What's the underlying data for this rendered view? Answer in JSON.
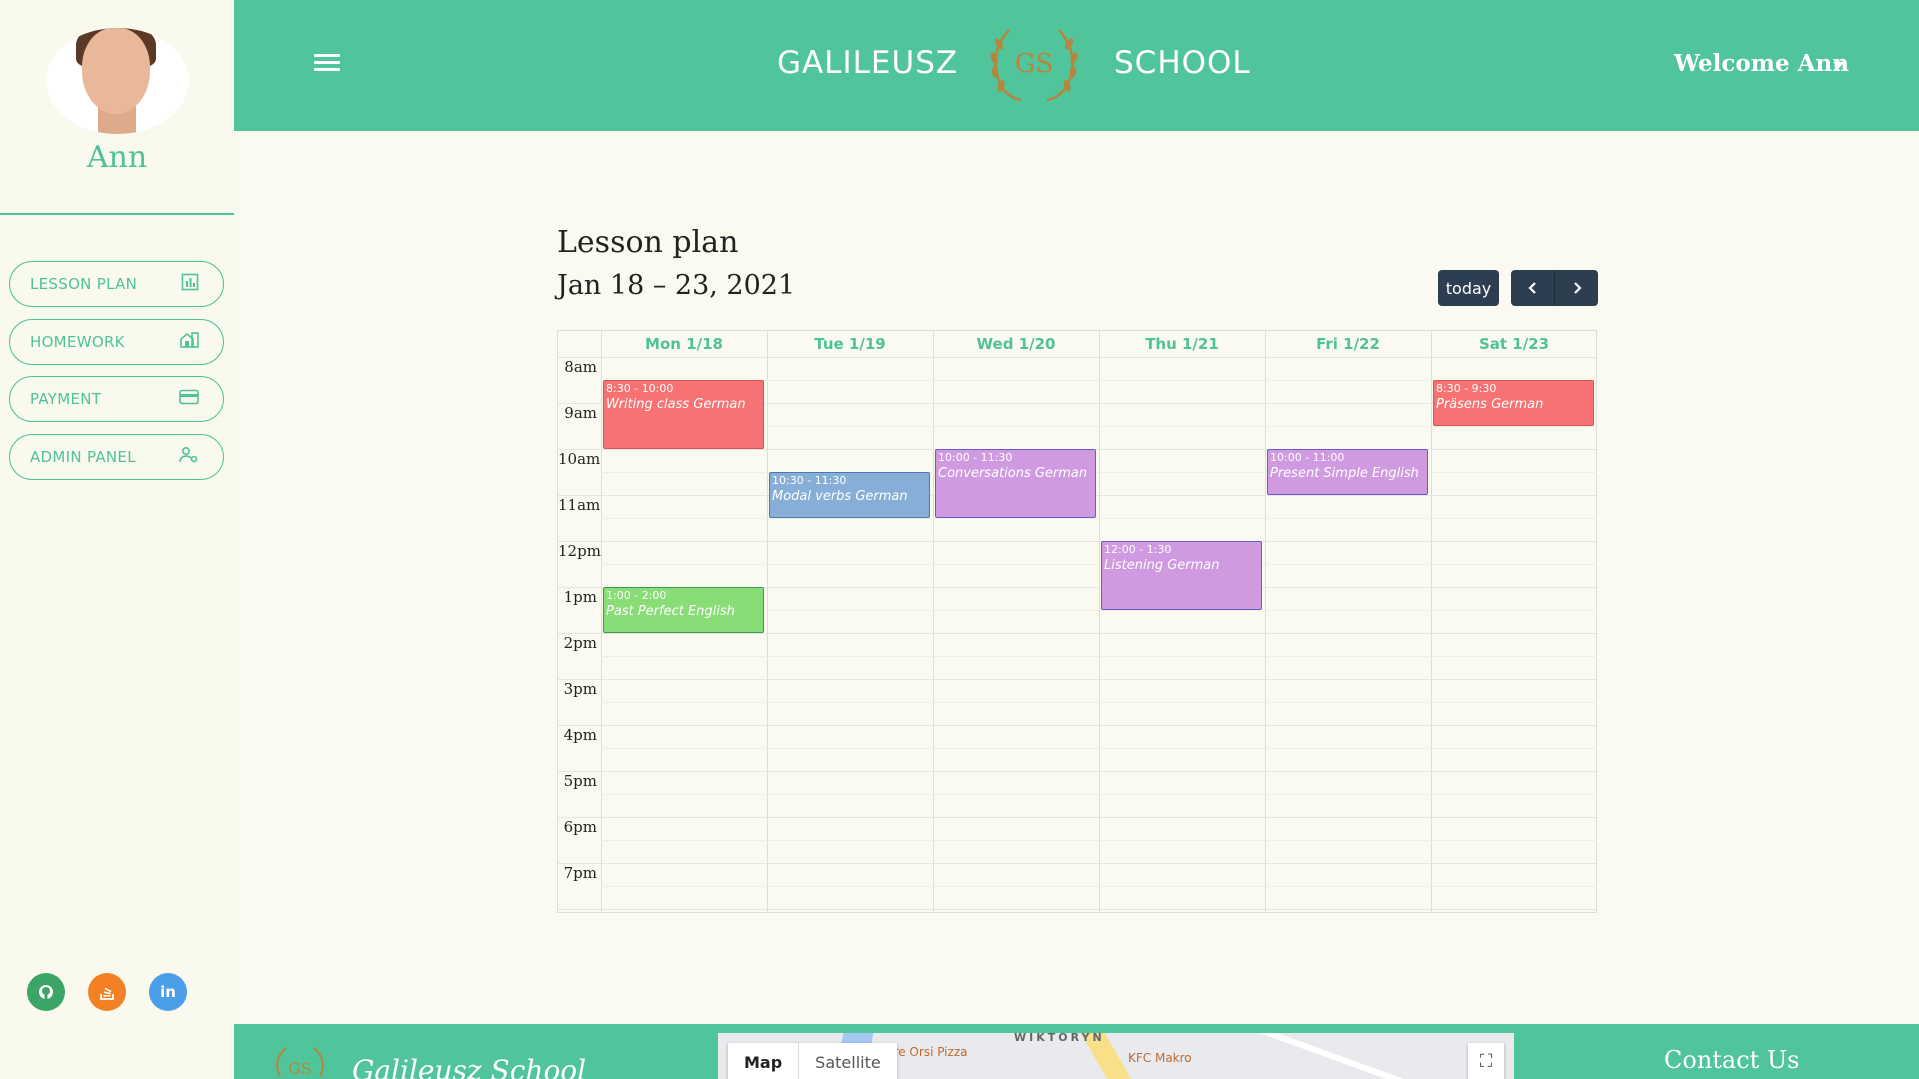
{
  "sidebar": {
    "user_name": "Ann",
    "nav": [
      {
        "label": "LESSON PLAN",
        "icon": "bar-chart-icon"
      },
      {
        "label": "HOMEWORK",
        "icon": "house-icon"
      },
      {
        "label": "PAYMENT",
        "icon": "credit-card-icon"
      },
      {
        "label": "ADMIN PANEL",
        "icon": "user-cog-icon"
      }
    ],
    "social": [
      {
        "icon": "github-icon",
        "color": "#3aa564"
      },
      {
        "icon": "stack-overflow-icon",
        "color": "#f48024"
      },
      {
        "icon": "linkedin-icon",
        "color": "#4a9fe8"
      }
    ]
  },
  "header": {
    "brand_left": "GALILEUSZ",
    "brand_right": "SCHOOL",
    "logo_text": "GS",
    "welcome": "Welcome Ann",
    "color": "#50c49a"
  },
  "calendar": {
    "title": "Lesson plan",
    "range": "Jan 18 – 23, 2021",
    "today_label": "today",
    "prev_icon": "chevron-left-icon",
    "next_icon": "chevron-right-icon",
    "days": [
      "Mon 1/18",
      "Tue 1/19",
      "Wed 1/20",
      "Thu 1/21",
      "Fri 1/22",
      "Sat 1/23"
    ],
    "times": [
      "8am",
      "9am",
      "10am",
      "11am",
      "12pm",
      "1pm",
      "2pm",
      "3pm",
      "4pm",
      "5pm",
      "6pm",
      "7pm"
    ],
    "events": [
      {
        "day": 0,
        "start": 8.5,
        "end": 10,
        "time": "8:30 - 10:00",
        "name": "Writing class German",
        "color": "#f77272",
        "border": "#d9534f"
      },
      {
        "day": 5,
        "start": 8.5,
        "end": 9.5,
        "time": "8:30 - 9:30",
        "name": "Präsens German",
        "color": "#f77272",
        "border": "#d9534f"
      },
      {
        "day": 2,
        "start": 10,
        "end": 11.5,
        "time": "10:00 - 11:30",
        "name": "Conversations German",
        "color": "#cf9ae0",
        "border": "#6a5acd"
      },
      {
        "day": 4,
        "start": 10,
        "end": 11,
        "time": "10:00 - 11:00",
        "name": "Present Simple English",
        "color": "#cf9ae0",
        "border": "#6a5acd"
      },
      {
        "day": 1,
        "start": 10.5,
        "end": 11.5,
        "time": "10:30 - 11:30",
        "name": "Modal verbs German",
        "color": "#86aed6",
        "border": "#4a7ab0"
      },
      {
        "day": 3,
        "start": 12,
        "end": 13.5,
        "time": "12:00 - 1:30",
        "name": "Listening German",
        "color": "#cf9ae0",
        "border": "#6a5acd"
      },
      {
        "day": 0,
        "start": 13,
        "end": 14,
        "time": "1:00 - 2:00",
        "name": "Past Perfect English",
        "color": "#88dd77",
        "border": "#3a9a5a"
      }
    ]
  },
  "footer": {
    "school_name": "Galileusz School",
    "map_tab_map": "Map",
    "map_tab_satellite": "Satellite",
    "map_labels": [
      "WIKTORYN",
      "Tre Orsi Pizza",
      "KFC Makro"
    ],
    "contact": "Contact Us"
  }
}
